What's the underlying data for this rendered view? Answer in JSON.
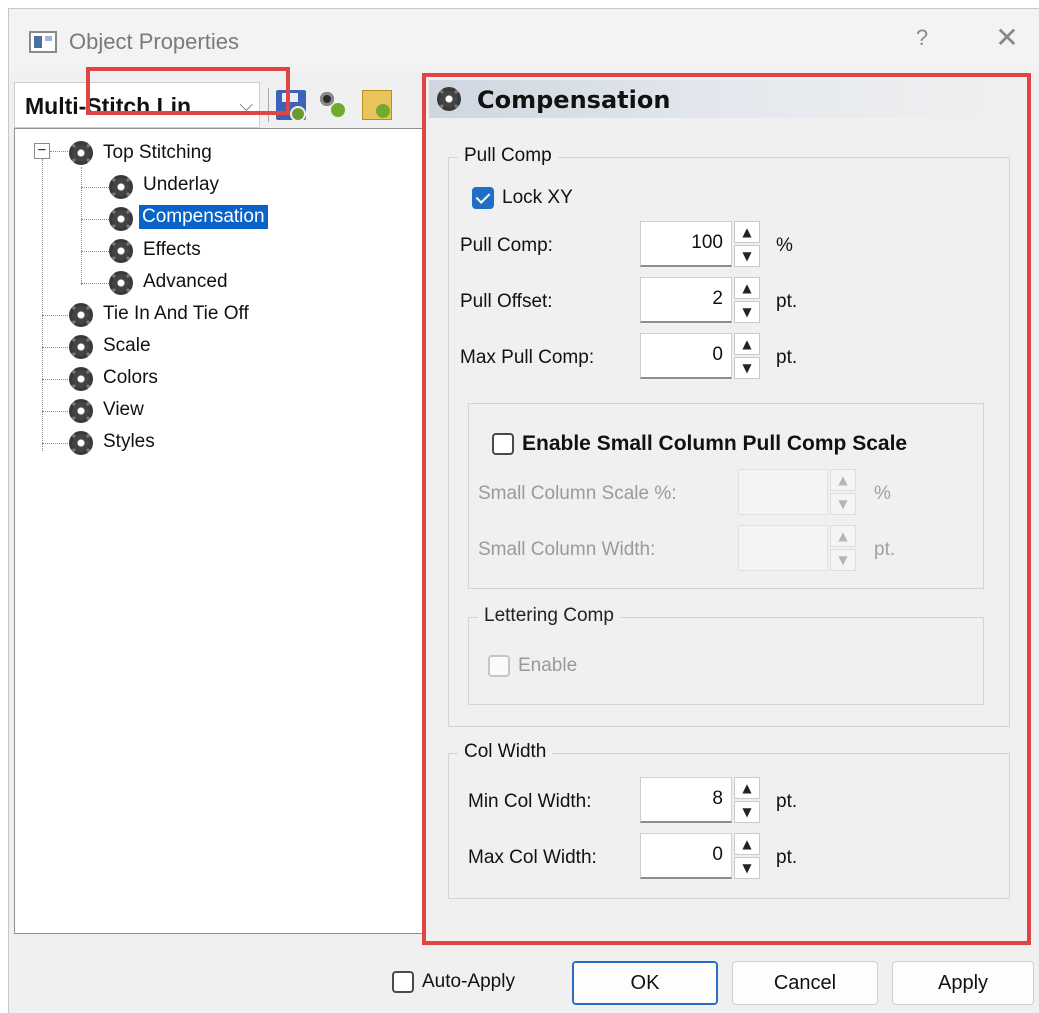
{
  "window": {
    "title": "Object Properties",
    "help_label": "?",
    "close_label": "✕"
  },
  "left_panel": {
    "combo_value": "Multi-Stitch Lin",
    "toolbar_icons": [
      "save-icon",
      "gears-icon",
      "folder-gear-icon"
    ],
    "tree": {
      "root": {
        "label": "Top Stitching",
        "expander": "−"
      },
      "children": [
        {
          "label": "Underlay"
        },
        {
          "label": "Compensation",
          "selected": true
        },
        {
          "label": "Effects"
        },
        {
          "label": "Advanced"
        }
      ],
      "siblings": [
        {
          "label": "Tie In And Tie Off"
        },
        {
          "label": "Scale"
        },
        {
          "label": "Colors"
        },
        {
          "label": "View"
        },
        {
          "label": "Styles"
        }
      ]
    }
  },
  "right_panel": {
    "section_title": "Compensation",
    "pull_comp": {
      "group_label": "Pull Comp",
      "lock_xy_label": "Lock XY",
      "lock_xy_checked": true,
      "fields": [
        {
          "label": "Pull Comp:",
          "value": "100",
          "unit": "%"
        },
        {
          "label": "Pull Offset:",
          "value": "2",
          "unit": "pt."
        },
        {
          "label": "Max Pull Comp:",
          "value": "0",
          "unit": "pt."
        }
      ],
      "small_column": {
        "enable_label": "Enable Small Column Pull Comp Scale",
        "enabled": false,
        "fields": [
          {
            "label": "Small Column Scale %:",
            "value": "",
            "unit": "%"
          },
          {
            "label": "Small Column Width:",
            "value": "",
            "unit": "pt."
          }
        ]
      },
      "lettering_comp": {
        "group_label": "Lettering Comp",
        "enable_label": "Enable",
        "enabled": false
      }
    },
    "col_width": {
      "group_label": "Col Width",
      "fields": [
        {
          "label": "Min Col Width:",
          "value": "8",
          "unit": "pt."
        },
        {
          "label": "Max Col Width:",
          "value": "0",
          "unit": "pt."
        }
      ]
    }
  },
  "footer": {
    "auto_apply_label": "Auto-Apply",
    "auto_apply_checked": false,
    "ok_label": "OK",
    "cancel_label": "Cancel",
    "apply_label": "Apply"
  },
  "colors": {
    "highlight_frame": "#e04545",
    "selection": "#0a63c9",
    "checkbox_accent": "#1f6fc9"
  }
}
